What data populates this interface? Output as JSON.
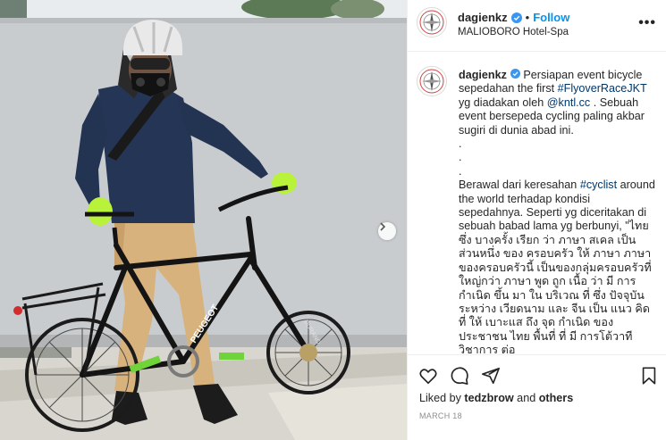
{
  "post": {
    "username": "dagienkz",
    "follow_label": "Follow",
    "dot": "•",
    "location": "MALIOBORO Hotel-Spa",
    "more_label": "•••"
  },
  "caption": {
    "username": "dagienkz",
    "part1": " Persiapan event bicycle sepedahan the first ",
    "hashtag1": "#FlyoverRaceJKT",
    "part2": " yg diadakan oleh ",
    "mention": "@kntl.cc",
    "part3": " . Sebuah event bersepeda cycling paling akbar sugiri di dunia abad ini.",
    "dots": [
      ".",
      ".",
      "."
    ],
    "part4": "Berawal dari keresahan ",
    "hashtag2": "#cyclist",
    "part5": " around the world terhadap kondisi sepedahnya. Seperti yg diceritakan di sebuah babad lama yg berbunyi, \"ไทย ซึ่ง บางครั้ง เรียก ว่า ภาษา สเคล เป็น ส่วนหนึ่ง ของ ครอบครัว ให้ ภาษา ภาษาของครอบครัวนี้ เป็นของกลุ่มครอบครัวที่ใหญ่กว่า ภาษา พูด ถูก เนื้อ ว่า มี การ กำเนิด ขึ้น มา ใน บริเวณ ที่ ซึ่ง ปัจจุบัน ระหว่าง เวียดนาม และ จีน เป็น แนว คิด ที่ ให้ เบาะแส ถึง จุด กำเนิด ของ ประชาชน ไทย พื้นที่ ที่ มี การโต้วาทีวิชาการ ต่อ"
  },
  "likes": {
    "prefix": "Liked by ",
    "user": "tedzbrow",
    "middle": " and ",
    "others": "others"
  },
  "date": "MARCH 18",
  "photo": {
    "bike_brand": "PEUGEOT",
    "tire_text": "DURANO"
  },
  "colors": {
    "accent": "#0095f6",
    "link": "#00376b",
    "muted": "#8e8e8e",
    "wall": "#c9cccf",
    "shirt": "#243555",
    "pants": "#d8b27c",
    "glove": "#b8f23a"
  }
}
